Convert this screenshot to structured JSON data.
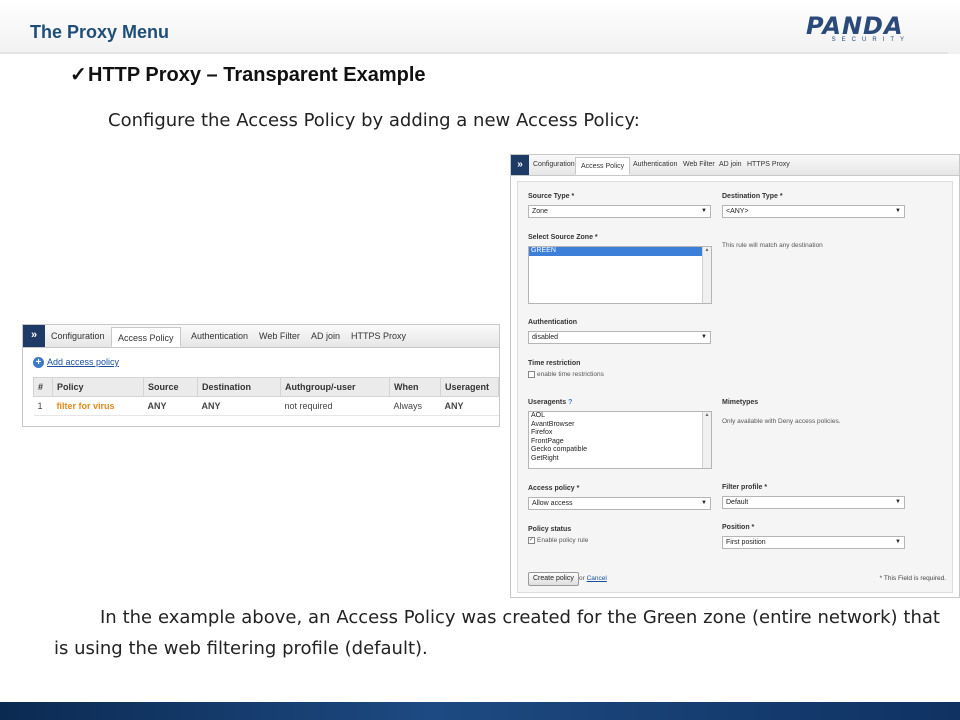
{
  "header": {
    "title": "The Proxy Menu",
    "logo_main": "PANDA",
    "logo_sub": "SECURITY"
  },
  "heading": {
    "check": "✓",
    "text": "HTTP Proxy – Transparent Example"
  },
  "intro": "Configure the Access Policy by adding a new Access Policy:",
  "tabs": [
    "Configuration",
    "Access Policy",
    "Authentication",
    "Web Filter",
    "AD join",
    "HTTPS Proxy"
  ],
  "expand_glyph": "»",
  "policy_list": {
    "add_label": "Add access policy",
    "columns": [
      "#",
      "Policy",
      "Source",
      "Destination",
      "Authgroup/-user",
      "When",
      "Useragent"
    ],
    "rows": [
      [
        "1",
        "filter for virus",
        "ANY",
        "ANY",
        "not required",
        "Always",
        "ANY"
      ]
    ]
  },
  "form": {
    "source_type_label": "Source Type *",
    "source_type_value": "Zone",
    "destination_type_label": "Destination Type *",
    "destination_type_value": "<ANY>",
    "source_zone_label": "Select Source Zone *",
    "source_zone_options": [
      "GREEN"
    ],
    "destination_note": "This rule will match any destination",
    "authentication_label": "Authentication",
    "authentication_value": "disabled",
    "time_restriction_label": "Time restriction",
    "time_restriction_checkbox": "enable time restrictions",
    "useragents_label": "Useragents",
    "useragents_help": "?",
    "useragents_options": [
      "AOL",
      "AvantBrowser",
      "Firefox",
      "FrontPage",
      "Gecko compatible",
      "GetRight"
    ],
    "mimetypes_label": "Mimetypes",
    "mimetypes_note": "Only available with Deny access policies.",
    "access_policy_label": "Access policy *",
    "access_policy_value": "Allow access",
    "filter_profile_label": "Filter profile *",
    "filter_profile_value": "Default",
    "policy_status_label": "Policy status",
    "policy_status_checkbox": "Enable policy rule",
    "position_label": "Position *",
    "position_value": "First position",
    "create_button": "Create policy",
    "or_text": "or",
    "cancel_link": "Cancel",
    "required_note": "* This Field is required."
  },
  "body_text": "In the example above, an Access Policy was created for the Green zone (entire network) that is using the web filtering profile (default)."
}
